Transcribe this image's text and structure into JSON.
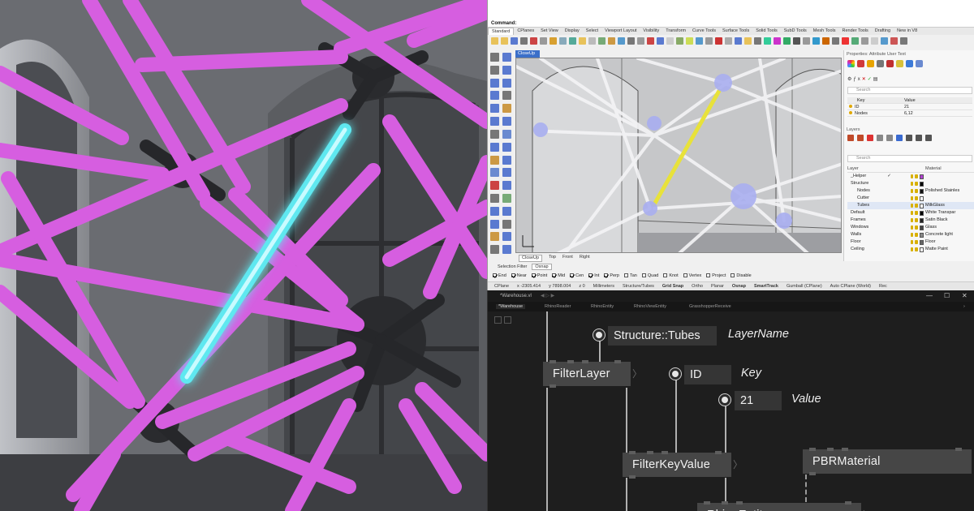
{
  "rhino": {
    "command_label": "Command:",
    "tabs": [
      "Standard",
      "CPlanes",
      "Set View",
      "Display",
      "Select",
      "Viewport Layout",
      "Visibility",
      "Transform",
      "Curve Tools",
      "Surface Tools",
      "Solid Tools",
      "SubD Tools",
      "Mesh Tools",
      "Render Tools",
      "Drafting",
      "New in V8"
    ],
    "viewport_tab": "CloseUp",
    "viewport_bottom_tabs": [
      "CloseUp",
      "Top",
      "Front",
      "Right"
    ],
    "properties_title": "Properties: Attribute User Text",
    "props_search_placeholder": "Search",
    "user_text": {
      "col_key": "Key",
      "col_value": "Value",
      "rows": [
        {
          "key": "ID",
          "value": "21"
        },
        {
          "key": "Nodes",
          "value": "6,12"
        }
      ]
    },
    "layers_title": "Layers",
    "layers_search_placeholder": "Search",
    "layers": {
      "col_layer": "Layer",
      "col_material": "Material",
      "rows": [
        {
          "name": "_Helper",
          "material": "",
          "swatch": "#b040d0",
          "check": "✓",
          "indent": 0
        },
        {
          "name": "Structure",
          "material": "",
          "swatch": "#000000",
          "check": "",
          "indent": 0
        },
        {
          "name": "Nodes",
          "material": "Polished Stainles",
          "swatch": "#111111",
          "check": "",
          "indent": 1
        },
        {
          "name": "Cutter",
          "material": "",
          "swatch": "#ffffff",
          "check": "",
          "indent": 1
        },
        {
          "name": "Tubes",
          "material": "MilkGlass",
          "swatch": "#ffffff",
          "check": "",
          "indent": 1
        },
        {
          "name": "Default",
          "material": "White Transpar",
          "swatch": "#000000",
          "check": "",
          "indent": 0
        },
        {
          "name": "Frames",
          "material": "Satin Black",
          "swatch": "#222222",
          "check": "",
          "indent": 0
        },
        {
          "name": "Windows",
          "material": "Glass",
          "swatch": "#444444",
          "check": "",
          "indent": 0
        },
        {
          "name": "Walls",
          "material": "Concrete light",
          "swatch": "#888888",
          "check": "",
          "indent": 0
        },
        {
          "name": "Floor",
          "material": "Floor",
          "swatch": "#666666",
          "check": "",
          "indent": 0
        },
        {
          "name": "Ceiling",
          "material": "Matte Paint",
          "swatch": "#ffffff",
          "check": "",
          "indent": 0
        }
      ]
    },
    "osnap_tabs": [
      "Selection Filter",
      "Osnap"
    ],
    "osnap_options": [
      {
        "label": "End",
        "on": true
      },
      {
        "label": "Near",
        "on": true
      },
      {
        "label": "Point",
        "on": true
      },
      {
        "label": "Mid",
        "on": true
      },
      {
        "label": "Cen",
        "on": true
      },
      {
        "label": "Int",
        "on": true
      },
      {
        "label": "Perp",
        "on": true
      },
      {
        "label": "Tan",
        "on": false
      },
      {
        "label": "Quad",
        "on": false
      },
      {
        "label": "Knot",
        "on": false
      },
      {
        "label": "Vertex",
        "on": false
      },
      {
        "label": "Project",
        "on": false
      },
      {
        "label": "Disable",
        "on": false
      }
    ],
    "status": {
      "cplane": "CPlane",
      "x": "x -2305.414",
      "y": "y 7898.004",
      "z": "z 0",
      "units": "Millimeters",
      "layer": "Structure/Tubes",
      "grid_snap": "Grid Snap",
      "ortho": "Ortho",
      "planar": "Planar",
      "osnap": "Osnap",
      "smarttrack": "SmartTrack",
      "gumball": "Gumball (CPlane)",
      "auto_cplane": "Auto CPlane (World)",
      "rec": "Rec"
    }
  },
  "vvvv": {
    "window_title": "*Warehouse.vl",
    "nav": "◀ ▷ ▶",
    "window_controls": {
      "minimize": "—",
      "maximize": "☐",
      "close": "✕"
    },
    "tabs": [
      "*Warehouse",
      "RhinoReader",
      "RhinoEntity",
      "RhinoViewEntity",
      "GrasshopperReceive"
    ],
    "nodes": {
      "filter_layer": "FilterLayer",
      "filter_key_value": "FilterKeyValue",
      "pbr_material": "PBRMaterial",
      "rhino_entity": "RhinoEntity"
    },
    "inputs": {
      "layer_value": "Structure::Tubes",
      "layer_label": "LayerName",
      "key_value": "ID",
      "key_label": "Key",
      "value_value": "21",
      "value_label": "Value"
    }
  },
  "colors": {
    "tube_pink": "#d65ee0",
    "tube_cyan": "#5ee8f0",
    "selection_yellow": "#e8e23a",
    "node_bg": "#464646",
    "canvas_bg": "#1e1e1e"
  }
}
